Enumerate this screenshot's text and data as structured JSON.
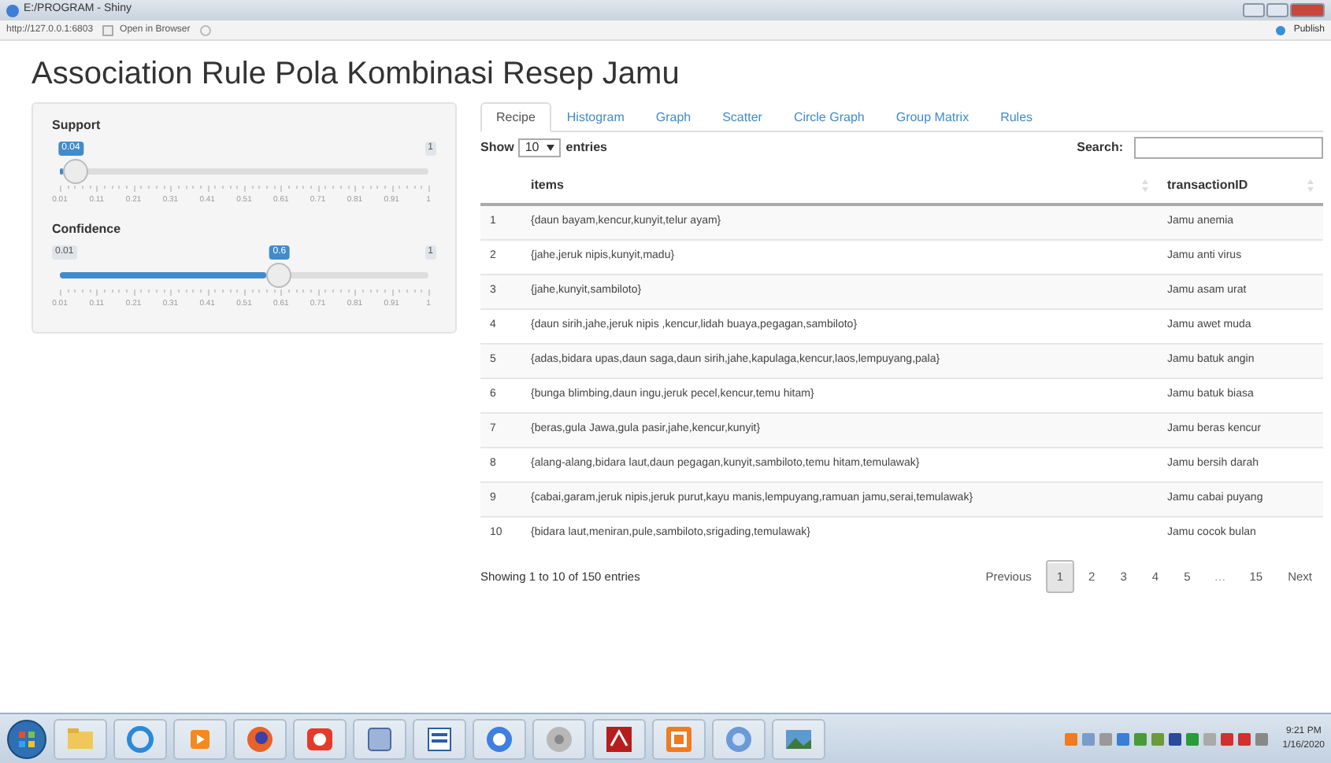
{
  "window": {
    "title": "E:/PROGRAM - Shiny"
  },
  "toolbar": {
    "address": "http://127.0.0.1:6803",
    "open_button": "Open in Browser",
    "publish_button": "Publish"
  },
  "page_title": "Association Rule Pola Kombinasi Resep Jamu",
  "sliders": [
    {
      "label": "Support",
      "value": "0.04",
      "max_label": "1",
      "level": 0.03,
      "ticks": [
        "0.01",
        "0.11",
        "0.21",
        "0.31",
        "0.41",
        "0.51",
        "0.61",
        "0.71",
        "0.81",
        "0.91",
        "1"
      ]
    },
    {
      "label": "Confidence",
      "min_label": "0.01",
      "value": "0.6",
      "max_label": "1",
      "level": 0.596,
      "ticks": [
        "0.01",
        "0.11",
        "0.21",
        "0.31",
        "0.41",
        "0.51",
        "0.61",
        "0.71",
        "0.81",
        "0.91",
        "1"
      ]
    }
  ],
  "tabs": [
    {
      "label": "Recipe",
      "selected": true
    },
    {
      "label": "Histogram",
      "selected": false
    },
    {
      "label": "Graph",
      "selected": false
    },
    {
      "label": "Scatter",
      "selected": false
    },
    {
      "label": "Circle Graph",
      "selected": false
    },
    {
      "label": "Group Matrix",
      "selected": false
    },
    {
      "label": "Rules",
      "selected": false
    }
  ],
  "table_controls": {
    "show_label": "Show",
    "length": "10",
    "entries_label": "entries",
    "search_label": "Search:"
  },
  "table": {
    "columns": [
      "items",
      "transactionID"
    ],
    "rows": [
      {
        "index": "1",
        "items": "{daun bayam,kencur,kunyit,telur ayam}",
        "transaction_id": "Jamu anemia"
      },
      {
        "index": "2",
        "items": "{jahe,jeruk nipis,kunyit,madu}",
        "transaction_id": "Jamu anti virus"
      },
      {
        "index": "3",
        "items": "{jahe,kunyit,sambiloto}",
        "transaction_id": "Jamu asam urat"
      },
      {
        "index": "4",
        "items": "{daun sirih,jahe,jeruk nipis ,kencur,lidah buaya,pegagan,sambiloto}",
        "transaction_id": "Jamu awet muda"
      },
      {
        "index": "5",
        "items": "{adas,bidara upas,daun saga,daun sirih,jahe,kapulaga,kencur,laos,lempuyang,pala}",
        "transaction_id": "Jamu batuk angin"
      },
      {
        "index": "6",
        "items": "{bunga blimbing,daun ingu,jeruk pecel,kencur,temu hitam}",
        "transaction_id": "Jamu batuk biasa"
      },
      {
        "index": "7",
        "items": "{beras,gula Jawa,gula pasir,jahe,kencur,kunyit}",
        "transaction_id": "Jamu beras kencur"
      },
      {
        "index": "8",
        "items": "{alang-alang,bidara laut,daun pegagan,kunyit,sambiloto,temu hitam,temulawak}",
        "transaction_id": "Jamu bersih darah"
      },
      {
        "index": "9",
        "items": "{cabai,garam,jeruk nipis,jeruk purut,kayu manis,lempuyang,ramuan jamu,serai,temulawak}",
        "transaction_id": "Jamu cabai puyang"
      },
      {
        "index": "10",
        "items": "{bidara laut,meniran,pule,sambiloto,srigading,temulawak}",
        "transaction_id": "Jamu cocok bulan"
      }
    ]
  },
  "info": "Showing 1 to 10 of 150 entries",
  "pagination": [
    {
      "kind": "link",
      "label": "Previous",
      "selected": false
    },
    {
      "kind": "link",
      "label": "1",
      "selected": true
    },
    {
      "kind": "link",
      "label": "2",
      "selected": false
    },
    {
      "kind": "link",
      "label": "3",
      "selected": false
    },
    {
      "kind": "link",
      "label": "4",
      "selected": false
    },
    {
      "kind": "link",
      "label": "5",
      "selected": false
    },
    {
      "kind": "ellipsis",
      "label": "…"
    },
    {
      "kind": "link",
      "label": "15",
      "selected": false
    },
    {
      "kind": "link",
      "label": "Next",
      "selected": false
    }
  ],
  "clock": {
    "time": "9:21 PM",
    "date": "1/16/2020"
  }
}
